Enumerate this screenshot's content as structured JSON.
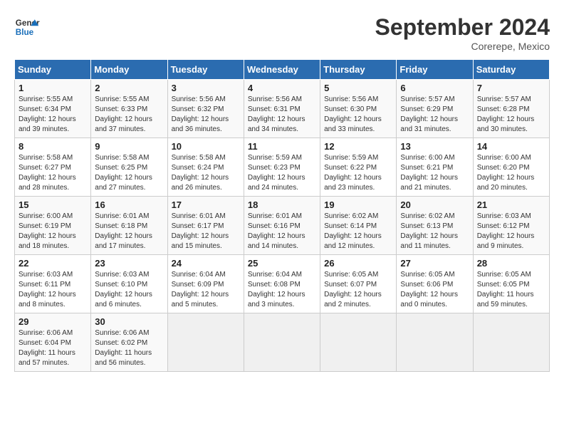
{
  "logo": {
    "line1": "General",
    "line2": "Blue"
  },
  "title": "September 2024",
  "location": "Corerepe, Mexico",
  "headers": [
    "Sunday",
    "Monday",
    "Tuesday",
    "Wednesday",
    "Thursday",
    "Friday",
    "Saturday"
  ],
  "weeks": [
    [
      {
        "day": "1",
        "info": "Sunrise: 5:55 AM\nSunset: 6:34 PM\nDaylight: 12 hours\nand 39 minutes."
      },
      {
        "day": "2",
        "info": "Sunrise: 5:55 AM\nSunset: 6:33 PM\nDaylight: 12 hours\nand 37 minutes."
      },
      {
        "day": "3",
        "info": "Sunrise: 5:56 AM\nSunset: 6:32 PM\nDaylight: 12 hours\nand 36 minutes."
      },
      {
        "day": "4",
        "info": "Sunrise: 5:56 AM\nSunset: 6:31 PM\nDaylight: 12 hours\nand 34 minutes."
      },
      {
        "day": "5",
        "info": "Sunrise: 5:56 AM\nSunset: 6:30 PM\nDaylight: 12 hours\nand 33 minutes."
      },
      {
        "day": "6",
        "info": "Sunrise: 5:57 AM\nSunset: 6:29 PM\nDaylight: 12 hours\nand 31 minutes."
      },
      {
        "day": "7",
        "info": "Sunrise: 5:57 AM\nSunset: 6:28 PM\nDaylight: 12 hours\nand 30 minutes."
      }
    ],
    [
      {
        "day": "8",
        "info": "Sunrise: 5:58 AM\nSunset: 6:27 PM\nDaylight: 12 hours\nand 28 minutes."
      },
      {
        "day": "9",
        "info": "Sunrise: 5:58 AM\nSunset: 6:25 PM\nDaylight: 12 hours\nand 27 minutes."
      },
      {
        "day": "10",
        "info": "Sunrise: 5:58 AM\nSunset: 6:24 PM\nDaylight: 12 hours\nand 26 minutes."
      },
      {
        "day": "11",
        "info": "Sunrise: 5:59 AM\nSunset: 6:23 PM\nDaylight: 12 hours\nand 24 minutes."
      },
      {
        "day": "12",
        "info": "Sunrise: 5:59 AM\nSunset: 6:22 PM\nDaylight: 12 hours\nand 23 minutes."
      },
      {
        "day": "13",
        "info": "Sunrise: 6:00 AM\nSunset: 6:21 PM\nDaylight: 12 hours\nand 21 minutes."
      },
      {
        "day": "14",
        "info": "Sunrise: 6:00 AM\nSunset: 6:20 PM\nDaylight: 12 hours\nand 20 minutes."
      }
    ],
    [
      {
        "day": "15",
        "info": "Sunrise: 6:00 AM\nSunset: 6:19 PM\nDaylight: 12 hours\nand 18 minutes."
      },
      {
        "day": "16",
        "info": "Sunrise: 6:01 AM\nSunset: 6:18 PM\nDaylight: 12 hours\nand 17 minutes."
      },
      {
        "day": "17",
        "info": "Sunrise: 6:01 AM\nSunset: 6:17 PM\nDaylight: 12 hours\nand 15 minutes."
      },
      {
        "day": "18",
        "info": "Sunrise: 6:01 AM\nSunset: 6:16 PM\nDaylight: 12 hours\nand 14 minutes."
      },
      {
        "day": "19",
        "info": "Sunrise: 6:02 AM\nSunset: 6:14 PM\nDaylight: 12 hours\nand 12 minutes."
      },
      {
        "day": "20",
        "info": "Sunrise: 6:02 AM\nSunset: 6:13 PM\nDaylight: 12 hours\nand 11 minutes."
      },
      {
        "day": "21",
        "info": "Sunrise: 6:03 AM\nSunset: 6:12 PM\nDaylight: 12 hours\nand 9 minutes."
      }
    ],
    [
      {
        "day": "22",
        "info": "Sunrise: 6:03 AM\nSunset: 6:11 PM\nDaylight: 12 hours\nand 8 minutes."
      },
      {
        "day": "23",
        "info": "Sunrise: 6:03 AM\nSunset: 6:10 PM\nDaylight: 12 hours\nand 6 minutes."
      },
      {
        "day": "24",
        "info": "Sunrise: 6:04 AM\nSunset: 6:09 PM\nDaylight: 12 hours\nand 5 minutes."
      },
      {
        "day": "25",
        "info": "Sunrise: 6:04 AM\nSunset: 6:08 PM\nDaylight: 12 hours\nand 3 minutes."
      },
      {
        "day": "26",
        "info": "Sunrise: 6:05 AM\nSunset: 6:07 PM\nDaylight: 12 hours\nand 2 minutes."
      },
      {
        "day": "27",
        "info": "Sunrise: 6:05 AM\nSunset: 6:06 PM\nDaylight: 12 hours\nand 0 minutes."
      },
      {
        "day": "28",
        "info": "Sunrise: 6:05 AM\nSunset: 6:05 PM\nDaylight: 11 hours\nand 59 minutes."
      }
    ],
    [
      {
        "day": "29",
        "info": "Sunrise: 6:06 AM\nSunset: 6:04 PM\nDaylight: 11 hours\nand 57 minutes."
      },
      {
        "day": "30",
        "info": "Sunrise: 6:06 AM\nSunset: 6:02 PM\nDaylight: 11 hours\nand 56 minutes."
      },
      null,
      null,
      null,
      null,
      null
    ]
  ]
}
